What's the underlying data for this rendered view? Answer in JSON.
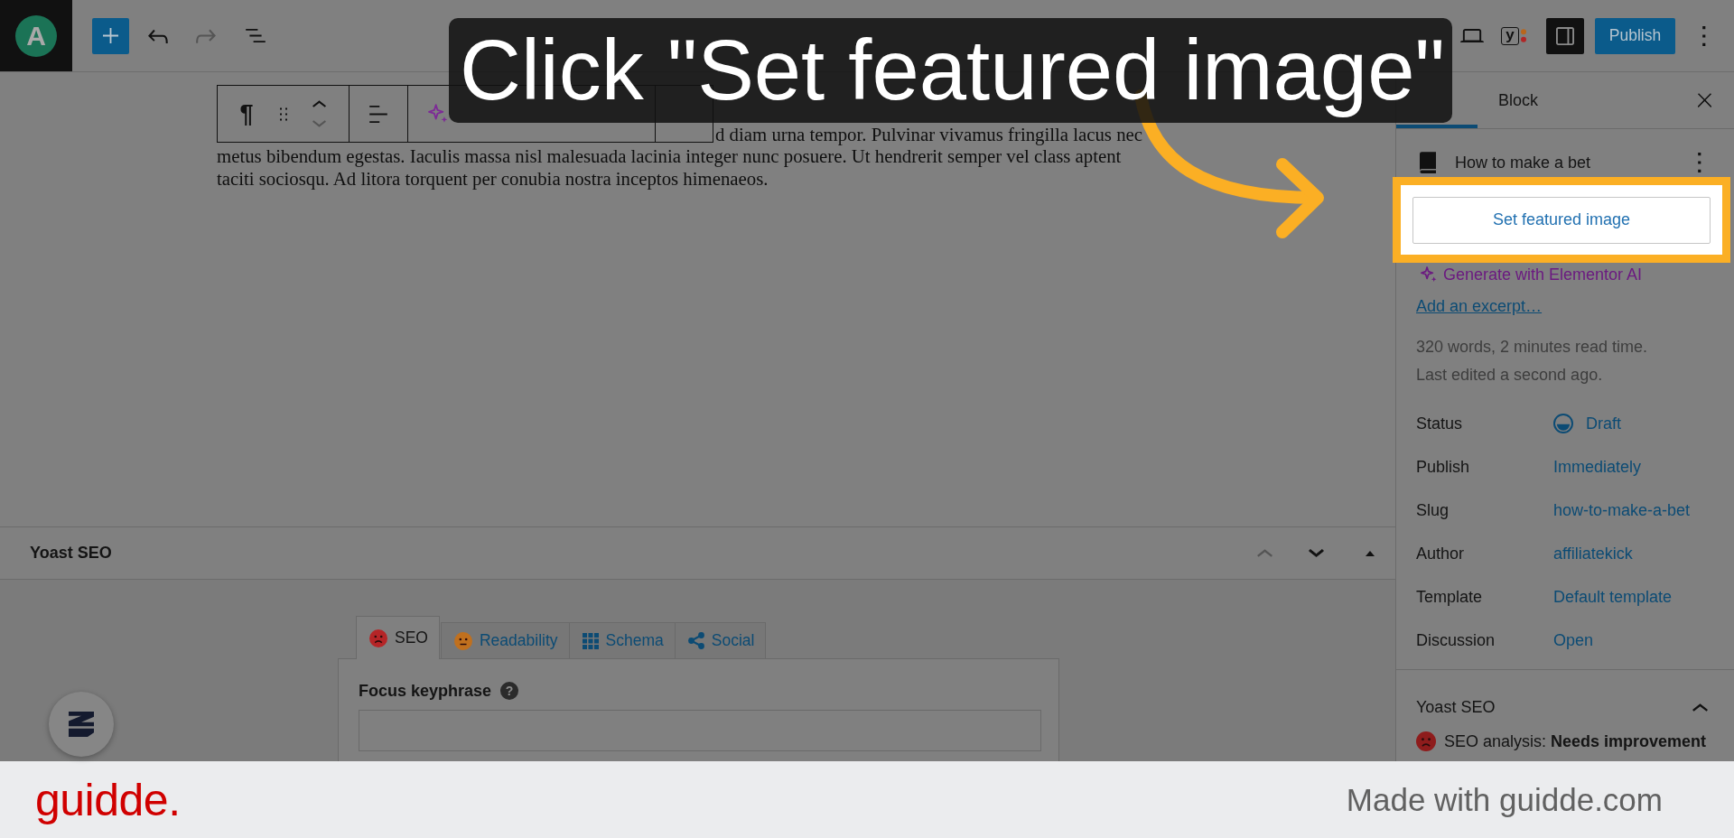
{
  "top_bar": {
    "logo_letter": "A",
    "redo_disabled": true,
    "plugin_letter": "y",
    "settings_pressed": true,
    "publish": "Publish"
  },
  "block_toolbar": {
    "block_symbol": "¶",
    "move_down_disabled": true
  },
  "paragraph": {
    "partial_lines": [
      "d diam urna tempor. Pulvinar vivamus fringilla lacus nec"
    ],
    "text": "metus bibendum egestas. Iaculis massa nisl malesuada lacinia integer nunc posuere. Ut hendrerit semper vel class aptent taciti sociosqu. Ad litora torquent per conubia nostra inceptos himenaeos."
  },
  "yoast_metabox": {
    "title": "Yoast SEO",
    "expanded": true,
    "tabs": [
      {
        "label": "SEO",
        "selected": true,
        "kind": "sad",
        "color": "#b52527"
      },
      {
        "label": "Readability",
        "selected": false,
        "kind": "neutral",
        "color": "#c0701e"
      },
      {
        "label": "Schema",
        "selected": false,
        "kind": "grid"
      },
      {
        "label": "Social",
        "selected": false,
        "kind": "share"
      }
    ],
    "focus_keyphrase": {
      "label": "Focus keyphrase",
      "help": "?"
    }
  },
  "sidebar": {
    "tabs": [
      {
        "selected": true
      },
      {
        "label": "Block",
        "selected": false
      }
    ],
    "post_title": "How to make a bet",
    "featured_image": {
      "label": "Set featured image",
      "highlighted": true
    },
    "ai_link": "Generate with Elementor AI",
    "excerpt_link": "Add an excerpt…",
    "stats": [
      "320 words, 2 minutes read time.",
      "Last edited a second ago."
    ],
    "fields": [
      {
        "label": "Status",
        "value": "Draft",
        "kind": "status"
      },
      {
        "label": "Publish",
        "value": "Immediately",
        "kind": "link"
      },
      {
        "label": "Slug",
        "value": "how-to-make-a-bet",
        "kind": "link"
      },
      {
        "label": "Author",
        "value": "affiliatekick",
        "kind": "link"
      },
      {
        "label": "Template",
        "value": "Default template",
        "kind": "link"
      },
      {
        "label": "Discussion",
        "value": "Open",
        "kind": "link"
      }
    ],
    "yoast": {
      "title": "Yoast SEO",
      "expanded": true,
      "analysis": "SEO analysis: **Needs improvement**"
    }
  },
  "annotation": {
    "caption": "Click \"Set featured image\""
  },
  "footer": {
    "logo": "guidde.",
    "credit": "Made with guidde.com"
  }
}
